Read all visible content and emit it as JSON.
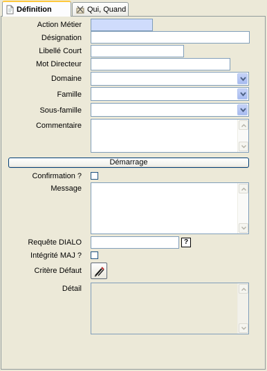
{
  "tabs": [
    {
      "label": "Définition",
      "icon": "document-icon",
      "active": true
    },
    {
      "label": "Qui, Quand",
      "icon": "tools-icon",
      "active": false
    }
  ],
  "form": {
    "action_metier_label": "Action Métier",
    "designation_label": "Désignation",
    "libelle_court_label": "Libellé Court",
    "mot_directeur_label": "Mot Directeur",
    "domaine_label": "Domaine",
    "famille_label": "Famille",
    "sous_famille_label": "Sous-famille",
    "commentaire_label": "Commentaire",
    "demarrage_button": "Démarrage",
    "confirmation_label": "Confirmation ?",
    "message_label": "Message",
    "requete_label": "Requête DIALO",
    "requete_help": "?",
    "integrite_label": "Intégrité MAJ ?",
    "critere_label": "Critère Défaut",
    "detail_label": "Détail",
    "action_metier_value": "",
    "designation_value": "",
    "libelle_court_value": "",
    "mot_directeur_value": "",
    "domaine_value": "",
    "famille_value": "",
    "sous_famille_value": "",
    "commentaire_value": "",
    "message_value": "",
    "requete_value": "",
    "detail_value": ""
  },
  "colors": {
    "panel_bg": "#ece9d8",
    "required_field_bg": "#cfdcfc",
    "field_border": "#7f9db9",
    "active_tab_accent": "#ffc83c"
  }
}
